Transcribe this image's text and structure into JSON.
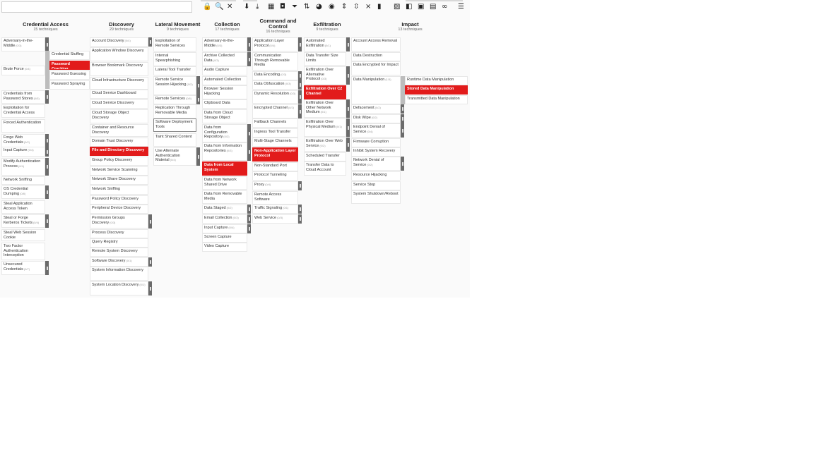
{
  "toolbar": {
    "icons": [
      "lock-icon",
      "search-icon",
      "close-icon",
      "download-icon",
      "export-icon",
      "grid-icon",
      "camera-icon",
      "filter-icon",
      "sort-icon",
      "palette-icon",
      "eye-icon",
      "expand-icon",
      "collapse-icon",
      "shrink-icon",
      "columns-icon",
      "pattern-icon",
      "fill-icon",
      "score-icon",
      "comment-icon",
      "link-icon",
      "list-icon"
    ]
  },
  "tactics": [
    {
      "name": "Credential Access",
      "count": "15 techniques"
    },
    {
      "name": "Discovery",
      "count": "29 techniques"
    },
    {
      "name": "Lateral Movement",
      "count": "9 techniques"
    },
    {
      "name": "Collection",
      "count": "17 techniques"
    },
    {
      "name": "Command and Control",
      "count": "16 techniques"
    },
    {
      "name": "Exfiltration",
      "count": "9 techniques"
    },
    {
      "name": "Impact",
      "count": "13 techniques"
    }
  ],
  "colors": {
    "highlight": "#e21b1b",
    "handle": "#6b6b6b",
    "bracket": "#bdbdbd"
  },
  "techniques": {
    "ca": [
      "Adversary-in-the-Middle",
      "Brute Force",
      "Credentials from Password Stores",
      "Exploitation for Credential Access",
      "Forced Authentication",
      "Forge Web Credentials",
      "Input Capture",
      "Modify Authentication Process",
      "Network Sniffing",
      "OS Credential Dumping",
      "Steal Application Access Token",
      "Steal or Forge Kerberos Tickets",
      "Steal Web Session Cookie",
      "Two Factor Authentication Interception",
      "Unsecured Credentials"
    ],
    "ca_sub": [
      "Credential Stuffing",
      "Password Cracking",
      "Password Guessing",
      "Password Spraying"
    ],
    "disc": [
      "Account Discovery",
      "Application Window Discovery",
      "Browser Bookmark Discovery",
      "Cloud Infrastructure Discovery",
      "Cloud Service Dashboard",
      "Cloud Service Discovery",
      "Cloud Storage Object Discovery",
      "Container and Resource Discovery",
      "Domain Trust Discovery",
      "File and Directory Discovery",
      "Group Policy Discovery",
      "Network Service Scanning",
      "Network Share Discovery",
      "Network Sniffing",
      "Password Policy Discovery",
      "Peripheral Device Discovery",
      "Permission Groups Discovery",
      "Process Discovery",
      "Query Registry",
      "Remote System Discovery",
      "Software Discovery",
      "System Information Discovery",
      "System Location Discovery"
    ],
    "lat": [
      "Exploitation of Remote Services",
      "Internal Spearphishing",
      "Lateral Tool Transfer",
      "Remote Service Session Hijacking",
      "Remote Services",
      "Replication Through Removable Media",
      "Software Deployment Tools",
      "Taint Shared Content",
      "Use Alternate Authentication Material"
    ],
    "coll": [
      "Adversary-in-the-Middle",
      "Archive Collected Data",
      "Audio Capture",
      "Automated Collection",
      "Browser Session Hijacking",
      "Clipboard Data",
      "Data from Cloud Storage Object",
      "Data from Configuration Repository",
      "Data from Information Repositories",
      "Data from Local System",
      "Data from Network Shared Drive",
      "Data from Removable Media",
      "Data Staged",
      "Email Collection",
      "Input Capture",
      "Screen Capture",
      "Video Capture"
    ],
    "c2": [
      "Application Layer Protocol",
      "Communication Through Removable Media",
      "Data Encoding",
      "Data Obfuscation",
      "Dynamic Resolution",
      "Encrypted Channel",
      "Fallback Channels",
      "Ingress Tool Transfer",
      "Multi-Stage Channels",
      "Non-Application Layer Protocol",
      "Non-Standard Port",
      "Protocol Tunneling",
      "Proxy",
      "Remote Access Software",
      "Traffic Signaling",
      "Web Service"
    ],
    "exf": [
      "Automated Exfiltration",
      "Data Transfer Size Limits",
      "Exfiltration Over Alternative Protocol",
      "Exfiltration Over C2 Channel",
      "Exfiltration Over Other Network Medium",
      "Exfiltration Over Physical Medium",
      "Exfiltration Over Web Service",
      "Scheduled Transfer",
      "Transfer Data to Cloud Account"
    ],
    "imp": [
      "Account Access Removal",
      "Data Destruction",
      "Data Encrypted for Impact",
      "Data Manipulation",
      "Defacement",
      "Disk Wipe",
      "Endpoint Denial of Service",
      "Firmware Corruption",
      "Inhibit System Recovery",
      "Network Denial of Service",
      "Resource Hijacking",
      "Service Stop",
      "System Shutdown/Reboot"
    ],
    "imp_sub": [
      "Runtime Data Manipulation",
      "Stored Data Manipulation",
      "Transmitted Data Manipulation"
    ]
  },
  "subcounts": {
    "ca": [
      "(0/3)",
      "(0/4)",
      "(0/5)",
      "",
      "",
      "(0/2)",
      "(0/4)",
      "(0/4)",
      "",
      "(0/8)",
      "",
      "(0/4)",
      "",
      "",
      "(0/7)"
    ],
    "disc": [
      "(0/4)",
      "",
      "",
      "",
      "",
      "",
      "",
      "",
      "",
      "",
      "",
      "",
      "",
      "",
      "",
      "",
      "(0/3)",
      "",
      "",
      "",
      "(0/1)",
      "",
      "(0/1)"
    ],
    "lat": [
      "",
      "",
      "",
      "(0/2)",
      "(0/6)",
      "",
      "",
      "",
      "(0/4)"
    ],
    "coll": [
      "(0/3)",
      "(0/3)",
      "",
      "",
      "",
      "",
      "",
      "(0/2)",
      "(0/3)",
      "",
      "",
      "",
      "(0/2)",
      "(0/3)",
      "(0/4)",
      "",
      ""
    ],
    "c2": [
      "(0/4)",
      "",
      "(0/3)",
      "(0/3)",
      "(0/3)",
      "(0/2)",
      "",
      "",
      "",
      "",
      "",
      "",
      "(0/4)",
      "",
      "(0/1)",
      "(0/3)"
    ],
    "exf": [
      "(0/1)",
      "",
      "(0/3)",
      "",
      "(0/1)",
      "(0/1)",
      "(0/2)",
      "",
      ""
    ],
    "imp": [
      "",
      "",
      "",
      "(1/3)",
      "(0/2)",
      "(0/2)",
      "(0/4)",
      "",
      "",
      "(0/2)",
      "",
      "",
      ""
    ]
  }
}
